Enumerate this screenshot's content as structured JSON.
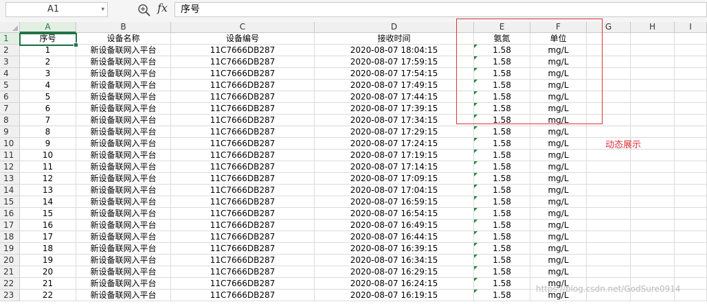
{
  "formula_bar": {
    "name_box": "A1",
    "fx": "fx",
    "formula": "序号"
  },
  "columns": [
    "A",
    "B",
    "C",
    "D",
    "E",
    "F",
    "G",
    "H",
    "I"
  ],
  "header": [
    "序号",
    "设备名称",
    "设备编号",
    "接收时间",
    "氨氮",
    "单位"
  ],
  "rows": [
    [
      "1",
      "新设备联网入平台",
      "11C7666DB287",
      "2020-08-07 18:04:15",
      "1.58",
      "mg/L"
    ],
    [
      "2",
      "新设备联网入平台",
      "11C7666DB287",
      "2020-08-07 17:59:15",
      "1.58",
      "mg/L"
    ],
    [
      "3",
      "新设备联网入平台",
      "11C7666DB287",
      "2020-08-07 17:54:15",
      "1.58",
      "mg/L"
    ],
    [
      "4",
      "新设备联网入平台",
      "11C7666DB287",
      "2020-08-07 17:49:15",
      "1.58",
      "mg/L"
    ],
    [
      "5",
      "新设备联网入平台",
      "11C7666DB287",
      "2020-08-07 17:44:15",
      "1.58",
      "mg/L"
    ],
    [
      "6",
      "新设备联网入平台",
      "11C7666DB287",
      "2020-08-07 17:39:15",
      "1.58",
      "mg/L"
    ],
    [
      "7",
      "新设备联网入平台",
      "11C7666DB287",
      "2020-08-07 17:34:15",
      "1.58",
      "mg/L"
    ],
    [
      "8",
      "新设备联网入平台",
      "11C7666DB287",
      "2020-08-07 17:29:15",
      "1.58",
      "mg/L"
    ],
    [
      "9",
      "新设备联网入平台",
      "11C7666DB287",
      "2020-08-07 17:24:15",
      "1.58",
      "mg/L"
    ],
    [
      "10",
      "新设备联网入平台",
      "11C7666DB287",
      "2020-08-07 17:19:15",
      "1.58",
      "mg/L"
    ],
    [
      "11",
      "新设备联网入平台",
      "11C7666DB287",
      "2020-08-07 17:14:15",
      "1.58",
      "mg/L"
    ],
    [
      "12",
      "新设备联网入平台",
      "11C7666DB287",
      "2020-08-07 17:09:15",
      "1.58",
      "mg/L"
    ],
    [
      "13",
      "新设备联网入平台",
      "11C7666DB287",
      "2020-08-07 17:04:15",
      "1.58",
      "mg/L"
    ],
    [
      "14",
      "新设备联网入平台",
      "11C7666DB287",
      "2020-08-07 16:59:15",
      "1.58",
      "mg/L"
    ],
    [
      "15",
      "新设备联网入平台",
      "11C7666DB287",
      "2020-08-07 16:54:15",
      "1.58",
      "mg/L"
    ],
    [
      "16",
      "新设备联网入平台",
      "11C7666DB287",
      "2020-08-07 16:49:15",
      "1.58",
      "mg/L"
    ],
    [
      "17",
      "新设备联网入平台",
      "11C7666DB287",
      "2020-08-07 16:44:15",
      "1.58",
      "mg/L"
    ],
    [
      "18",
      "新设备联网入平台",
      "11C7666DB287",
      "2020-08-07 16:39:15",
      "1.58",
      "mg/L"
    ],
    [
      "19",
      "新设备联网入平台",
      "11C7666DB287",
      "2020-08-07 16:34:15",
      "1.58",
      "mg/L"
    ],
    [
      "20",
      "新设备联网入平台",
      "11C7666DB287",
      "2020-08-07 16:29:15",
      "1.58",
      "mg/L"
    ],
    [
      "21",
      "新设备联网入平台",
      "11C7666DB287",
      "2020-08-07 16:24:15",
      "1.58",
      "mg/L"
    ],
    [
      "22",
      "新设备联网入平台",
      "11C7666DB287",
      "2020-08-07 16:19:15",
      "1.58",
      "mg/L"
    ]
  ],
  "annotation": "动态展示",
  "watermark": "https://blog.csdn.net/GodSure0914",
  "colors": {
    "selection_green": "#217346",
    "annotation_red": "#e0303a",
    "error_triangle": "#1e8a3a"
  }
}
